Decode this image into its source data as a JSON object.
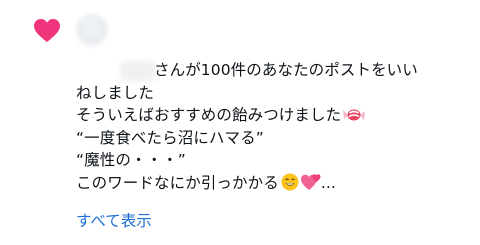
{
  "notification": {
    "type_icon": "heart-icon",
    "accent_color": "#f0357d",
    "link_color": "#1d6fd6",
    "lines": [
      "さんが100件のあなたのポストをいい",
      "ねしました",
      "そういえばおすすめの飴みつけました",
      "“一度食べたら沼にハマる”",
      "“魔性の・・・”",
      "このワードなにか引っかかる",
      "..."
    ],
    "emojis": [
      "candy-emoji",
      "grinning-face-emoji",
      "two-hearts-emoji"
    ],
    "show_all_label": "すべて表示"
  }
}
